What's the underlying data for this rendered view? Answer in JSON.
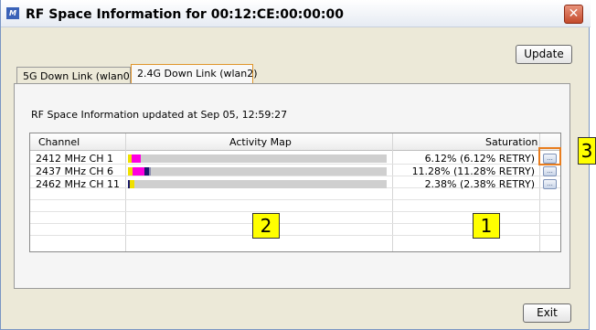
{
  "window": {
    "title": "RF Space Information for 00:12:CE:00:00:00",
    "icon": "app-icon",
    "close_icon": "close-icon"
  },
  "toolbar": {
    "update_label": "Update"
  },
  "tabs": [
    {
      "label": "5G Down Link (wlan0)",
      "selected": false
    },
    {
      "label": "2.4G Down Link (wlan2)",
      "selected": true
    }
  ],
  "panel": {
    "info_text": "RF Space Information updated at Sep 05, 12:59:27",
    "columns": {
      "channel": "Channel",
      "activity": "Activity Map",
      "saturation": "Saturation"
    },
    "rows": [
      {
        "channel": "2412 MHz CH 1",
        "saturation": "6.12% (6.12% RETRY)",
        "segments": [
          {
            "color": "#f0e000",
            "value": 1.5
          },
          {
            "color": "#ff00e0",
            "value": 3.3
          }
        ],
        "detail_label": "..."
      },
      {
        "channel": "2437 MHz CH 6",
        "saturation": "11.28% (11.28% RETRY)",
        "segments": [
          {
            "color": "#f0e000",
            "value": 1.8
          },
          {
            "color": "#ff00e0",
            "value": 4.6
          },
          {
            "color": "#1a1a6e",
            "value": 1.6
          },
          {
            "color": "#8a8ab0",
            "value": 0.8
          }
        ],
        "detail_label": "..."
      },
      {
        "channel": "2462 MHz CH 11",
        "saturation": "2.38% (2.38% RETRY)",
        "segments": [
          {
            "color": "#1a1a6e",
            "value": 0.6
          },
          {
            "color": "#f0e000",
            "value": 1.8
          }
        ],
        "detail_label": "..."
      }
    ]
  },
  "footer": {
    "exit_label": "Exit"
  },
  "callouts": {
    "one": "1",
    "two": "2",
    "three": "3"
  }
}
